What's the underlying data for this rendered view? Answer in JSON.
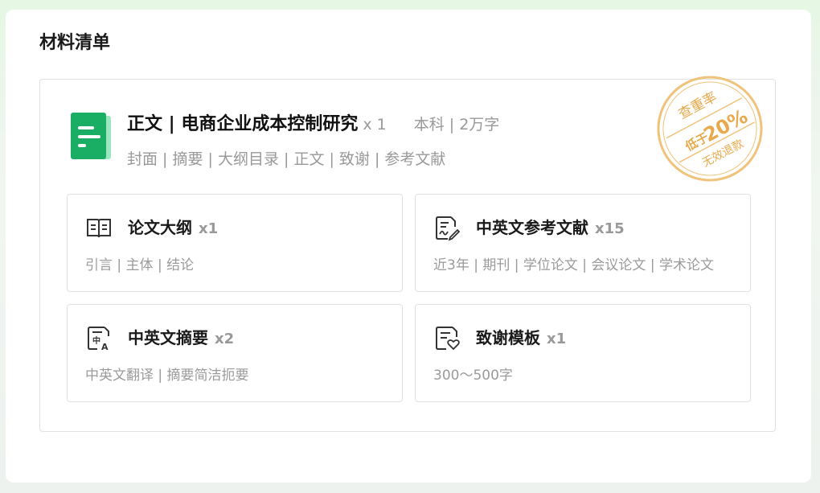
{
  "section_title": "材料清单",
  "main_item": {
    "name": "正文 | 电商企业成本控制研究",
    "quantity": "x 1",
    "spec": "本科 | 2万字",
    "contents": "封面 | 摘要 | 大纲目录 | 正文 | 致谢 | 参考文献",
    "icon": "document-icon",
    "color": "#1aae65"
  },
  "stamp": {
    "top": "查重率",
    "middle_prefix": "低于",
    "middle_value": "20%",
    "bottom": "无效退款",
    "color": "#f0c27a"
  },
  "items": [
    {
      "name": "论文大纲",
      "quantity": "x1",
      "desc": "引言 | 主体 | 结论",
      "icon": "book-icon"
    },
    {
      "name": "中英文参考文献",
      "quantity": "x15",
      "desc": "近3年 | 期刊 | 学位论文 | 会议论文 | 学术论文",
      "icon": "document-signature-icon"
    },
    {
      "name": "中英文摘要",
      "quantity": "x2",
      "desc": "中英文翻译 | 摘要简洁扼要",
      "icon": "translate-icon"
    },
    {
      "name": "致谢模板",
      "quantity": "x1",
      "desc": "300～500字",
      "icon": "heart-document-icon"
    }
  ]
}
